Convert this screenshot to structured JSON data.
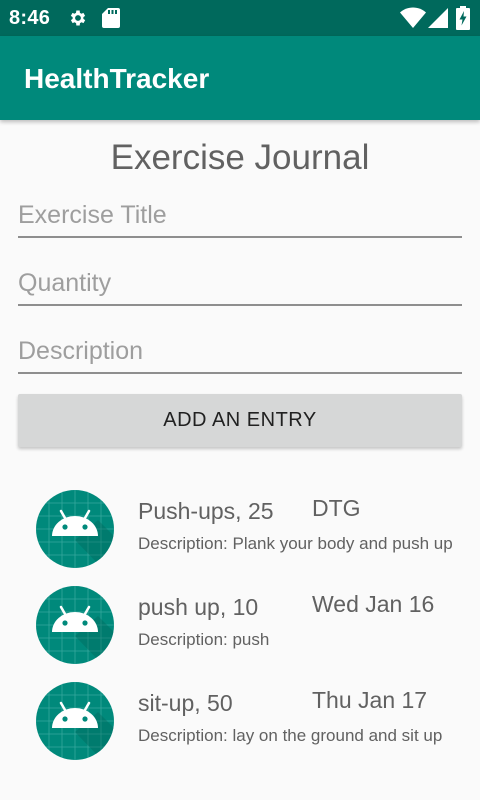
{
  "status_bar": {
    "time": "8:46",
    "icons": [
      "gear-icon",
      "sd-card-icon",
      "wifi-icon",
      "cell-signal-icon",
      "battery-charging-icon"
    ]
  },
  "app_bar": {
    "title": "HealthTracker",
    "color": "#00897b",
    "status_color": "#00695c"
  },
  "page": {
    "title": "Exercise Journal"
  },
  "form": {
    "exercise_title_placeholder": "Exercise Title",
    "quantity_placeholder": "Quantity",
    "description_placeholder": "Description",
    "add_button_label": "ADD AN ENTRY"
  },
  "entries": [
    {
      "title": "Push-ups, 25",
      "date": "DTG",
      "description": "Description: Plank your body and push up"
    },
    {
      "title": "push up, 10",
      "date": "Wed Jan 16",
      "description": "Description: push"
    },
    {
      "title": "sit-up, 50",
      "date": "Thu Jan 17",
      "description": "Description: lay on the ground and sit up"
    }
  ],
  "icons": {
    "entry_avatar": "android-icon"
  }
}
